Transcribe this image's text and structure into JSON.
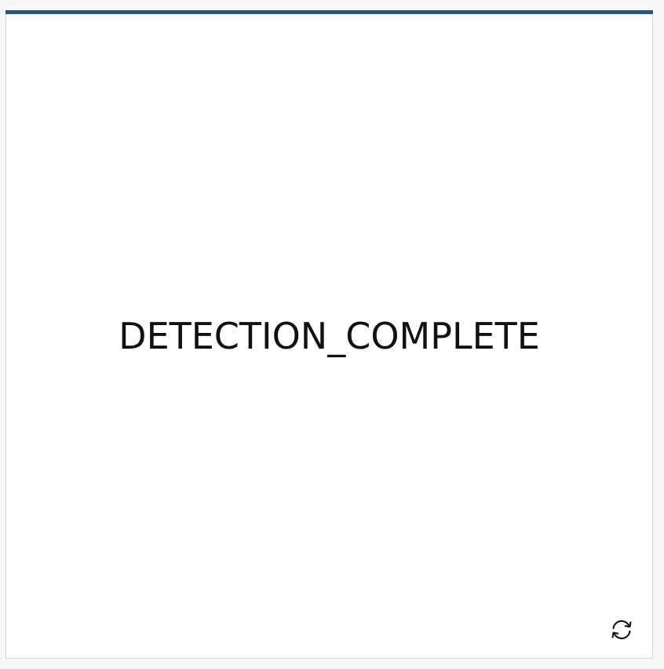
{
  "widget": {
    "status": "DETECTION_COMPLETE",
    "accent_color": "#2b5676",
    "refresh_icon": "refresh-icon"
  }
}
